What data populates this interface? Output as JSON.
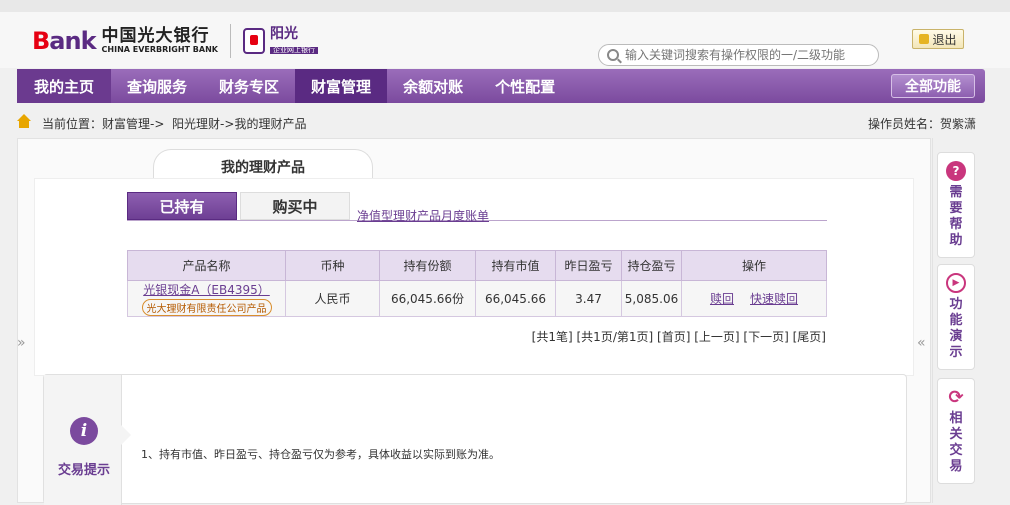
{
  "brand": {
    "logo_mark_a": "B",
    "logo_mark_b": "ank",
    "name_cn": "中国光大银行",
    "name_en": "CHINA EVERBRIGHT BANK",
    "sub_cn": "阳光",
    "sub_tag": "企业网上银行"
  },
  "header": {
    "logout_label": "退出",
    "search_placeholder": "输入关键词搜索有操作权限的一/二级功能"
  },
  "nav": {
    "items": [
      {
        "label": "我的主页"
      },
      {
        "label": "查询服务"
      },
      {
        "label": "财务专区"
      },
      {
        "label": "财富管理"
      },
      {
        "label": "余额对账"
      },
      {
        "label": "个性配置"
      }
    ],
    "all_label": "全部功能",
    "active_index": 3
  },
  "breadcrumb": {
    "prefix": "当前位置：",
    "path": [
      "财富管理->",
      "阳光理财->",
      "我的理财产品"
    ]
  },
  "operator": "操作员姓名：贺紫潇",
  "page": {
    "tab_title": "我的理财产品",
    "subtabs": [
      "已持有",
      "购买中"
    ],
    "report_link": "净值型理财产品月度账单"
  },
  "table": {
    "headers": [
      "产品名称",
      "币种",
      "持有份额",
      "持有市值",
      "昨日盈亏",
      "持仓盈亏",
      "操作"
    ],
    "rows": [
      {
        "name": "光银现金A（EB4395）",
        "tag": "光大理财有限责任公司产品",
        "currency": "人民币",
        "shares": "66,045.66份",
        "market_value": "66,045.66",
        "yesterday_pl": "3.47",
        "position_pl": "5,085.06",
        "actions": [
          "赎回",
          "快速赎回"
        ]
      }
    ]
  },
  "pager": {
    "count": "[共1笔]",
    "pages": "[共1页/第1页]",
    "first": "[首页]",
    "prev": "[上一页]",
    "next": "[下一页]",
    "last": "[尾页]"
  },
  "tips": {
    "icon_glyph": "i",
    "label": "交易提示",
    "text": "1、持有市值、昨日盈亏、持仓盈亏仅为参考，具体收益以实际到账为准。"
  },
  "sidebar": {
    "buttons": [
      {
        "label": "需要帮助",
        "icon": "help-icon",
        "glyph": "?",
        "color": "#c9367d"
      },
      {
        "label": "功能演示",
        "icon": "play-icon",
        "glyph": "▶",
        "color": "#c9367d"
      },
      {
        "label": "相关交易",
        "icon": "refresh-icon",
        "glyph": "⟳",
        "color": "#c9367d"
      }
    ]
  },
  "colors": {
    "brand_purple": "#5a2a82",
    "nav_purple": "#7b4a9e",
    "brand_red": "#e60012"
  }
}
